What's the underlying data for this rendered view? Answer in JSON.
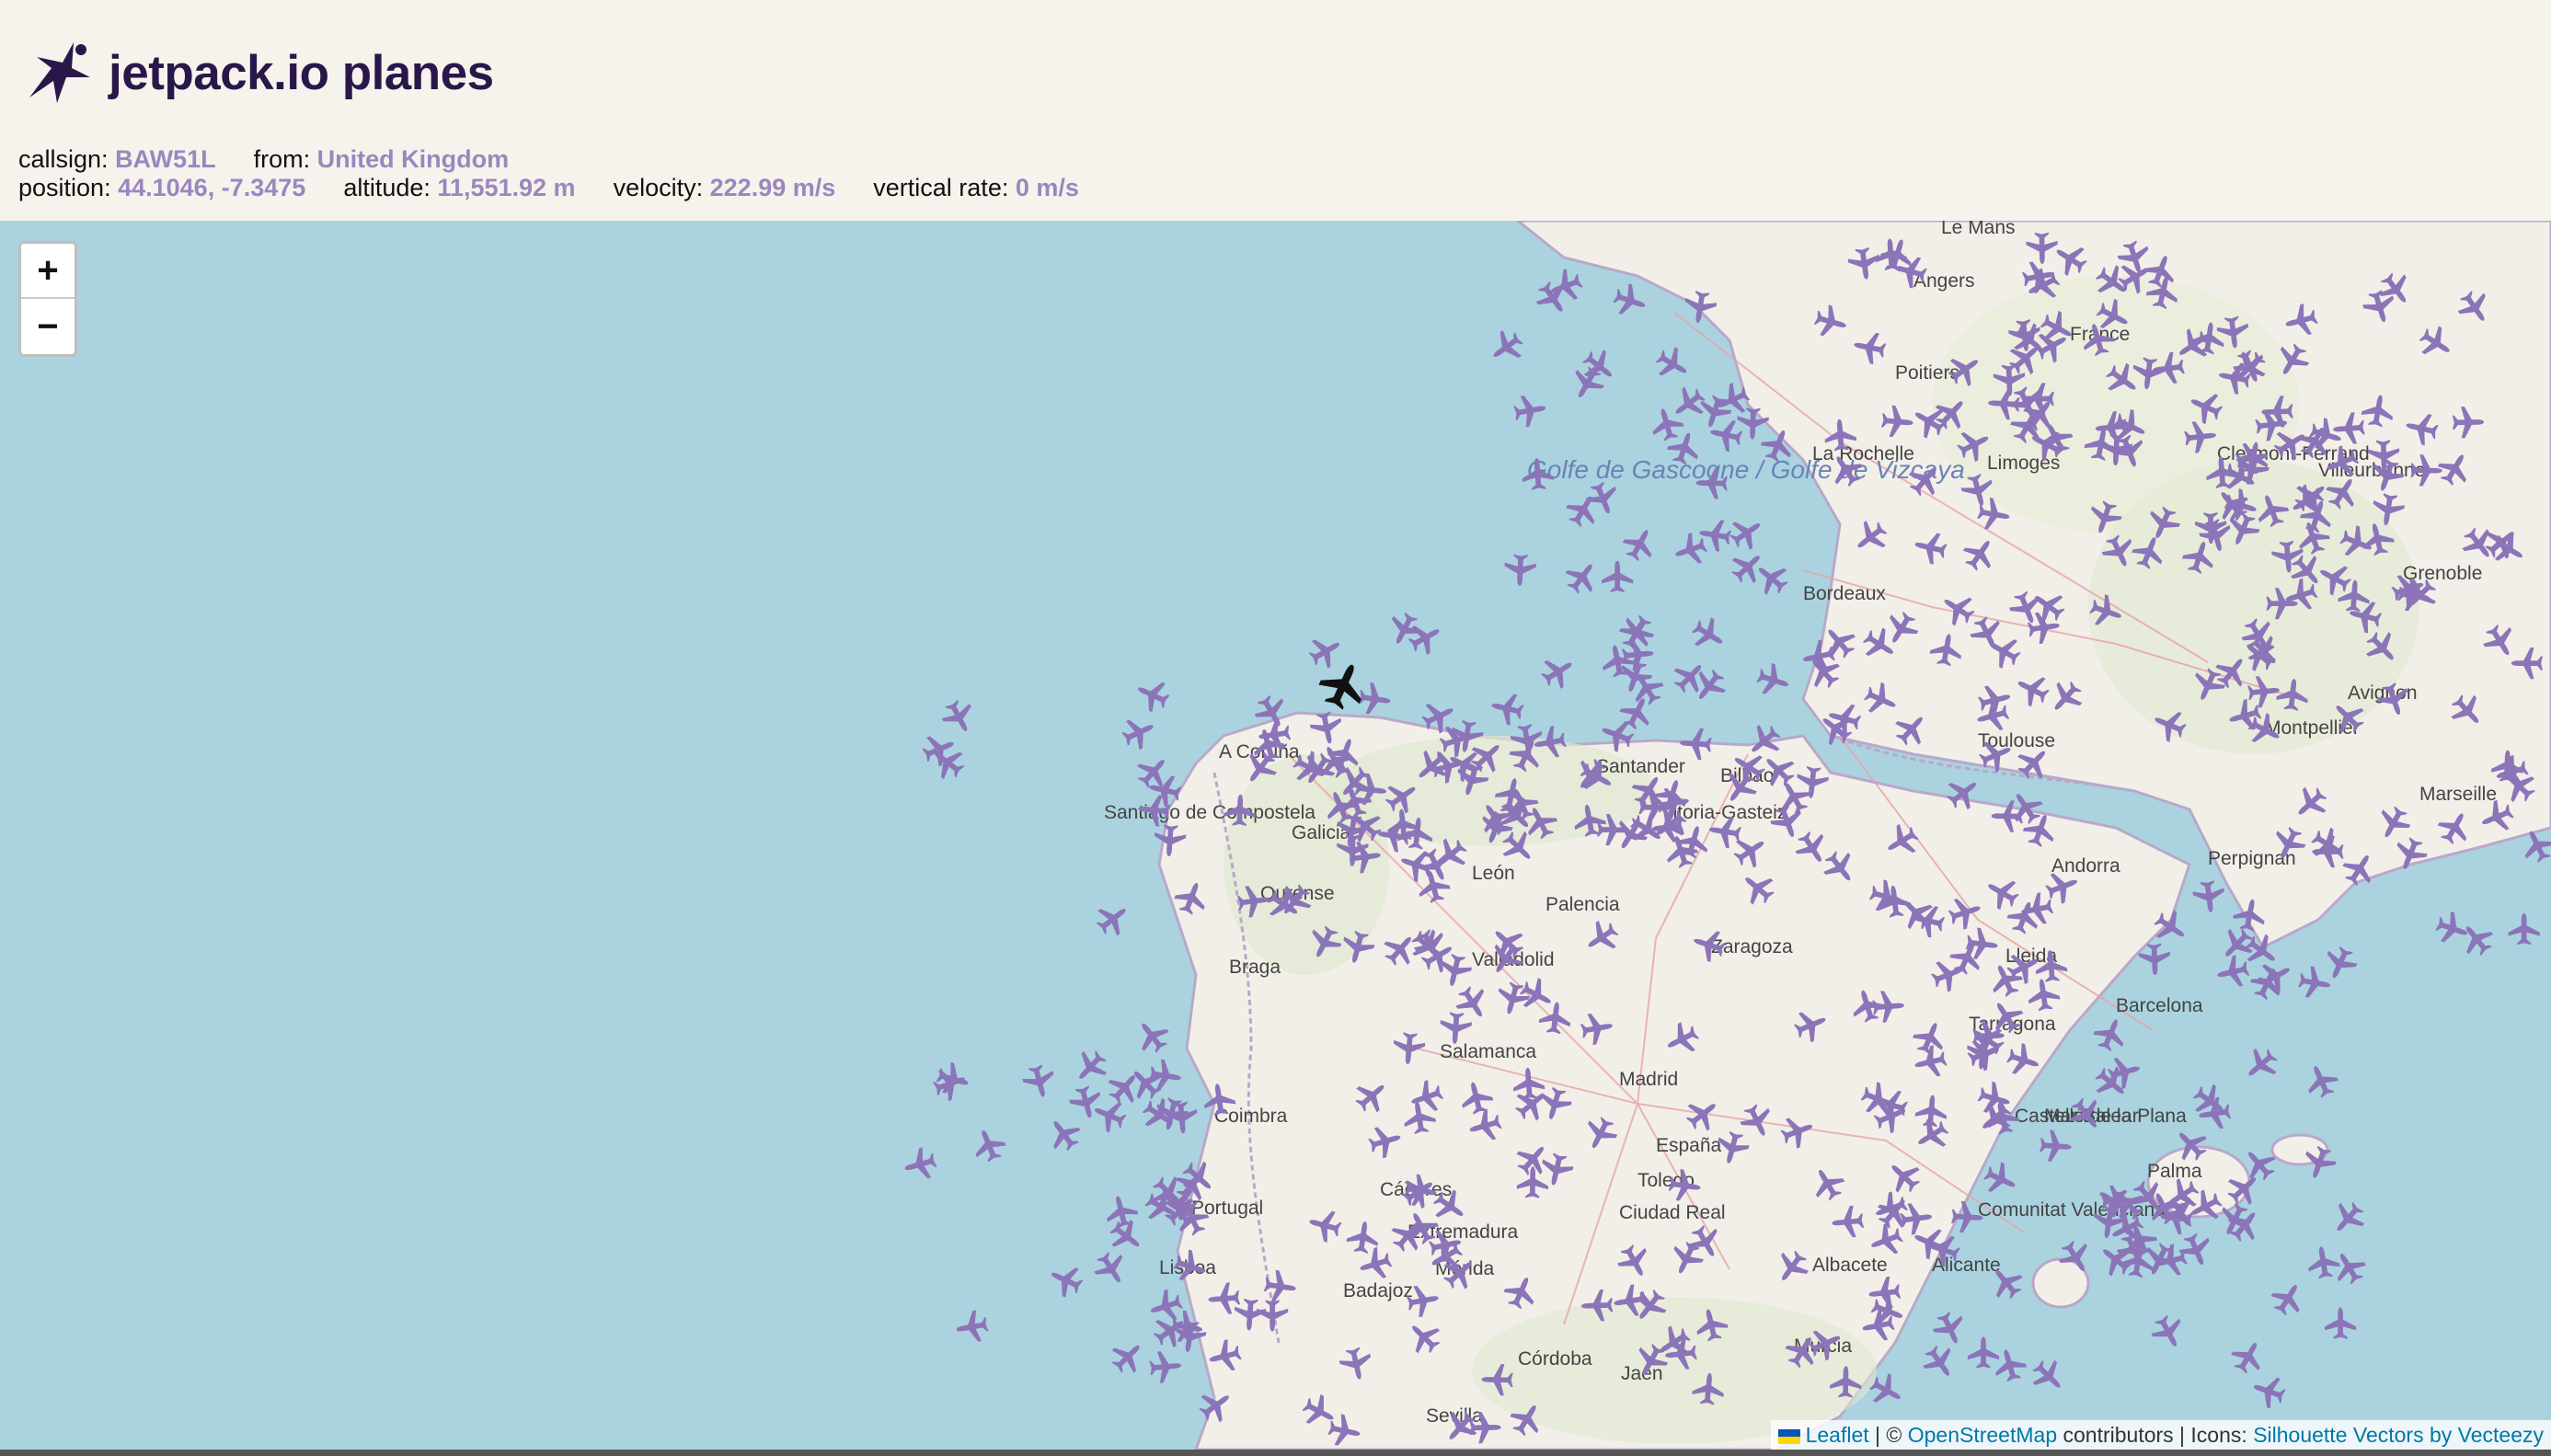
{
  "app": {
    "title": "jetpack.io planes",
    "logo_icon": "jetpack-logo-icon"
  },
  "flight": {
    "callsign_label": "callsign:",
    "callsign": "BAW51L",
    "from_label": "from:",
    "from": "United Kingdom",
    "position_label": "position:",
    "position": "44.1046, -7.3475",
    "altitude_label": "altitude:",
    "altitude": "11,551.92 m",
    "velocity_label": "velocity:",
    "velocity": "222.99 m/s",
    "vertical_rate_label": "vertical rate:",
    "vertical_rate": "0 m/s"
  },
  "map": {
    "zoom_in_label": "+",
    "zoom_out_label": "−",
    "place_labels": [
      "Le Mans",
      "Angers",
      "France",
      "Poitiers",
      "La Rochelle",
      "Limoges",
      "Clermont-Ferrand",
      "Villeurbanne",
      "Grenoble",
      "Bordeaux",
      "Toulouse",
      "Montpellier",
      "Avignon",
      "Marseille",
      "Perpignan",
      "Andorra",
      "Golfe de Gascogne / Golfe de Vizcaya",
      "A Coruña",
      "Santiago de Compostela",
      "Ourense",
      "Braga",
      "Santander",
      "Bilbao",
      "Vitoria-Gasteiz",
      "León",
      "Palencia",
      "Valladolid",
      "Zaragoza",
      "Lleida",
      "Tarragona",
      "Barcelona",
      "Salamanca",
      "Madrid",
      "España",
      "Coimbra",
      "Portugal",
      "Lisboa",
      "Cáceres",
      "Toledo",
      "Ciudad Real",
      "Castelló de la Plana",
      "Palma",
      "Mar Balear",
      "Mérida",
      "Badajoz",
      "Albacete",
      "Alicante",
      "Córdoba",
      "Jaén",
      "Sevilla",
      "Murcia",
      "Galicia",
      "Extremadura",
      "Comunitat Valenciana"
    ],
    "selected_plane": "selected-plane-icon",
    "plane_icon": "plane-icon"
  },
  "attribution": {
    "leaflet": "Leaflet",
    "separator": " | © ",
    "osm": "OpenStreetMap",
    "contributors": " contributors | Icons: ",
    "icons": "Silhouette Vectors by Vecteezy"
  },
  "colors": {
    "accent": "#9b86c0",
    "plane": "#8c74b8",
    "sea": "#aad3df",
    "land": "#f2efe9",
    "brand": "#2a174a"
  }
}
